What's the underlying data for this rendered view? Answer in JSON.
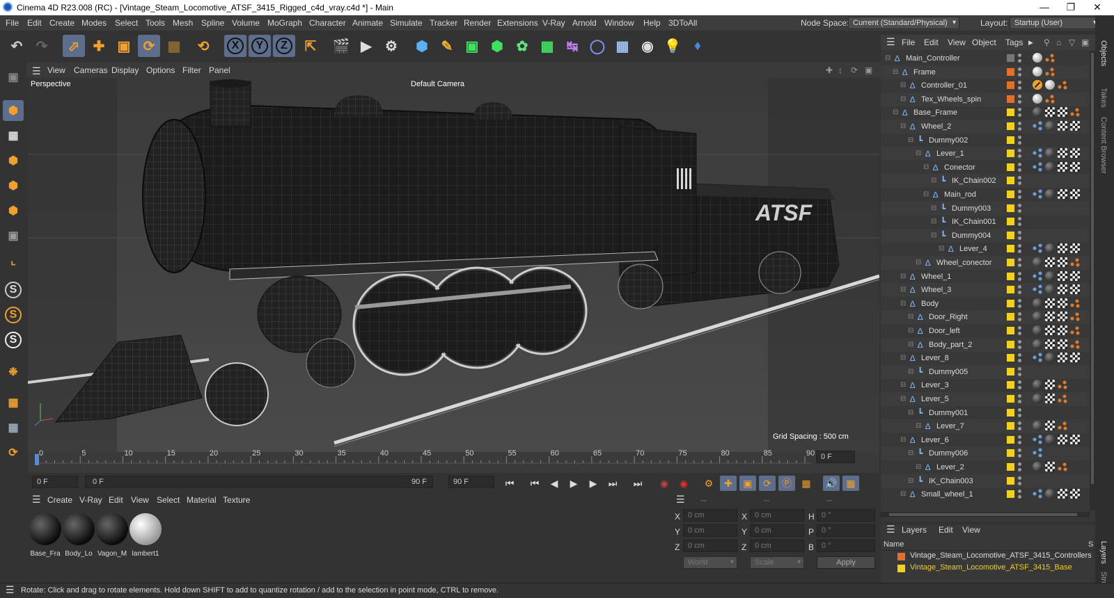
{
  "window": {
    "title": "Cinema 4D R23.008 (RC) - [Vintage_Steam_Locomotive_ATSF_3415_Rigged_c4d_vray.c4d *] - Main",
    "minimize": "—",
    "maximize": "❐",
    "close": "✕"
  },
  "menubar": {
    "items": [
      "File",
      "Edit",
      "Create",
      "Modes",
      "Select",
      "Tools",
      "Mesh",
      "Spline",
      "Volume",
      "MoGraph",
      "Character",
      "Animate",
      "Simulate",
      "Tracker",
      "Render",
      "Extensions",
      "V-Ray",
      "Arnold",
      "Window",
      "Help",
      "3DToAll"
    ],
    "node_space_label": "Node Space:",
    "node_space_value": "Current (Standard/Physical)",
    "layout_label": "Layout:",
    "layout_value": "Startup (User)"
  },
  "toolbar": {
    "axis_x": "X",
    "axis_y": "Y",
    "axis_z": "Z"
  },
  "viewport": {
    "menu": [
      "View",
      "Cameras",
      "Display",
      "Options",
      "Filter",
      "Panel"
    ],
    "label": "Perspective",
    "camera": "Default Camera",
    "grid_spacing": "Grid Spacing : 500 cm",
    "railcar_letters": "ATSF"
  },
  "timeline": {
    "ticks": [
      "0",
      "5",
      "10",
      "15",
      "20",
      "25",
      "30",
      "35",
      "40",
      "45",
      "50",
      "55",
      "60",
      "65",
      "70",
      "75",
      "80",
      "85",
      "90"
    ],
    "current_frame": "0 F",
    "start_frame": "0 F",
    "range_start": "0 F",
    "range_end": "90 F",
    "end_frame": "90 F"
  },
  "materials": {
    "menu": [
      "Create",
      "V-Ray",
      "Edit",
      "View",
      "Select",
      "Material",
      "Texture"
    ],
    "items": [
      {
        "name": "Base_Fra"
      },
      {
        "name": "Body_Lo"
      },
      {
        "name": "Vagon_M"
      },
      {
        "name": "lambert1"
      }
    ]
  },
  "coordinates": {
    "headers": [
      "--",
      "--",
      "--"
    ],
    "rows": [
      {
        "a": "X",
        "av": "0 cm",
        "b": "X",
        "bv": "0 cm",
        "c": "H",
        "cv": "0 °"
      },
      {
        "a": "Y",
        "av": "0 cm",
        "b": "Y",
        "bv": "0 cm",
        "c": "P",
        "cv": "0 °"
      },
      {
        "a": "Z",
        "av": "0 cm",
        "b": "Z",
        "bv": "0 cm",
        "c": "B",
        "cv": "0 °"
      }
    ],
    "space": "World",
    "mode": "Scale",
    "apply": "Apply"
  },
  "objects": {
    "menu": [
      "File",
      "Edit",
      "View",
      "Object",
      "Tags"
    ],
    "rows": [
      {
        "name": "Main_Controller",
        "swatch": "check"
      },
      {
        "name": "Frame",
        "swatch": "orange"
      },
      {
        "name": "Controller_01",
        "swatch": "orange"
      },
      {
        "name": "Tex_Wheels_spin",
        "swatch": "orange"
      },
      {
        "name": "Base_Frame",
        "swatch": "yellow"
      },
      {
        "name": "Wheel_2",
        "swatch": "yellow"
      },
      {
        "name": "Dummy002",
        "swatch": "yellow"
      },
      {
        "name": "Lever_1",
        "swatch": "yellow"
      },
      {
        "name": "Conector",
        "swatch": "yellow"
      },
      {
        "name": "IK_Chain002",
        "swatch": "yellow"
      },
      {
        "name": "Main_rod",
        "swatch": "yellow"
      },
      {
        "name": "Dummy003",
        "swatch": "yellow"
      },
      {
        "name": "IK_Chain001",
        "swatch": "yellow"
      },
      {
        "name": "Dummy004",
        "swatch": "yellow"
      },
      {
        "name": "Lever_4",
        "swatch": "yellow"
      },
      {
        "name": "Wheel_conector",
        "swatch": "yellow"
      },
      {
        "name": "Wheel_1",
        "swatch": "yellow"
      },
      {
        "name": "Wheel_3",
        "swatch": "yellow"
      },
      {
        "name": "Body",
        "swatch": "yellow"
      },
      {
        "name": "Door_Right",
        "swatch": "yellow"
      },
      {
        "name": "Door_left",
        "swatch": "yellow"
      },
      {
        "name": "Body_part_2",
        "swatch": "yellow"
      },
      {
        "name": "Lever_8",
        "swatch": "yellow"
      },
      {
        "name": "Dummy005",
        "swatch": "yellow"
      },
      {
        "name": "Lever_3",
        "swatch": "yellow"
      },
      {
        "name": "Lever_5",
        "swatch": "yellow"
      },
      {
        "name": "Dummy001",
        "swatch": "yellow"
      },
      {
        "name": "Lever_7",
        "swatch": "yellow"
      },
      {
        "name": "Lever_6",
        "swatch": "yellow"
      },
      {
        "name": "Dummy006",
        "swatch": "yellow"
      },
      {
        "name": "Lever_2",
        "swatch": "yellow"
      },
      {
        "name": "IK_Chain003",
        "swatch": "yellow"
      },
      {
        "name": "Small_wheel_1",
        "swatch": "yellow"
      }
    ]
  },
  "layers": {
    "menu": [
      "Layers",
      "Edit",
      "View"
    ],
    "column_name": "Name",
    "column_s": "S",
    "rows": [
      {
        "name": "Vintage_Steam_Locomotive_ATSF_3415_Controllers",
        "color": "#e0702a"
      },
      {
        "name": "Vintage_Steam_Locomotive_ATSF_3415_Base",
        "color": "#f0d020"
      }
    ]
  },
  "right_tabs": [
    "Objects",
    "Takes",
    "Content Browser",
    "Layers",
    "Stru"
  ],
  "status": "Rotate: Click and drag to rotate elements. Hold down SHIFT to add to quantize rotation / add to the selection in point mode, CTRL to remove.",
  "colors": {
    "accent_selected": "#5c6e8c",
    "swatch_orange": "#e0702a",
    "swatch_yellow": "#f0d020",
    "layer_base_text": "#f0d020"
  }
}
